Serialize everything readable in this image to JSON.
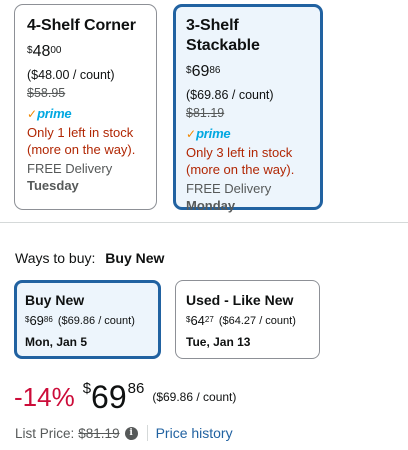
{
  "variations": [
    {
      "title": "4-Shelf Corner",
      "price": {
        "symbol": "$",
        "whole": "48",
        "fraction": "00"
      },
      "per_count": "($48.00 / count)",
      "list_price": "$58.95",
      "prime_label": "prime",
      "stock": "Only 1 left in stock (more on the way).",
      "delivery": "FREE Delivery",
      "delivery_day": "Tuesday",
      "selected": false
    },
    {
      "title": "3-Shelf Stackable",
      "price": {
        "symbol": "$",
        "whole": "69",
        "fraction": "86"
      },
      "per_count": "($69.86 / count)",
      "list_price": "$81.19",
      "prime_label": "prime",
      "stock": "Only 3 left in stock (more on the way).",
      "delivery": "FREE Delivery",
      "delivery_day": "Monday",
      "selected": true
    }
  ],
  "ways_to_buy": {
    "label": "Ways to buy:",
    "selected": "Buy New",
    "options": [
      {
        "title": "Buy New",
        "price": {
          "symbol": "$",
          "whole": "69",
          "fraction": "86"
        },
        "per_count": "($69.86 / count)",
        "date": "Mon, Jan 5",
        "selected": true
      },
      {
        "title": "Used - Like New",
        "price": {
          "symbol": "$",
          "whole": "64",
          "fraction": "27"
        },
        "per_count": "($64.27 / count)",
        "date": "Tue, Jan 13",
        "selected": false
      }
    ]
  },
  "main_price": {
    "discount": "-14%",
    "symbol": "$",
    "whole": "69",
    "fraction": "86",
    "per_count": "($69.86 / count)"
  },
  "list_price": {
    "label": "List Price:",
    "value": "$81.19",
    "info_icon": "info-icon",
    "price_history": "Price history"
  },
  "colors": {
    "selected_border": "#2162a1",
    "selected_bg": "#edf5fc",
    "deal_red": "#cc0c39",
    "stock_red": "#b12704",
    "prime_blue": "#00a8e1",
    "link_blue": "#2162a1"
  }
}
